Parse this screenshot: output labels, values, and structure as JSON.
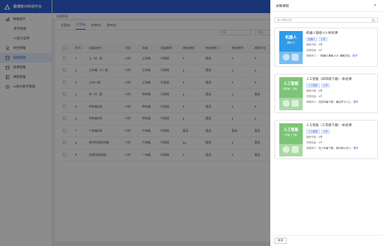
{
  "brand": {
    "title": "猫博智AI科创平台"
  },
  "sidebar": {
    "items": [
      {
        "label": "数据统计",
        "icon": "chart-icon",
        "expanded": true
      },
      {
        "label": "教学数据",
        "sub": true
      },
      {
        "label": "AI能力运用",
        "sub": true
      },
      {
        "label": "师生管理",
        "icon": "user-icon"
      },
      {
        "label": "班级管理",
        "icon": "class-icon",
        "active": true
      },
      {
        "label": "排课管理",
        "icon": "calendar-icon"
      },
      {
        "label": "课程管理",
        "icon": "book-icon"
      },
      {
        "label": "AI能力教学管理",
        "icon": "ai-icon"
      }
    ]
  },
  "breadcrumb": "班级管理",
  "tabs": [
    {
      "label": "全部(9)"
    },
    {
      "label": "小学(9)",
      "active": true
    },
    {
      "label": "初中(0)"
    },
    {
      "label": "高中(0)"
    }
  ],
  "filters": {
    "left": "年级",
    "right": "班级"
  },
  "table": {
    "headers": [
      "",
      "序号",
      "班级名称 ↕",
      "学段",
      "年级",
      "班级属性",
      "关联课程",
      "附加课程 ⓘ",
      "关联教师",
      "关联学生"
    ],
    "rows": [
      [
        "1",
        "三（5）班",
        "小学",
        "三年级",
        "行政班",
        "2",
        "暂无",
        "1",
        "3"
      ],
      [
        "2",
        "三年级（1）班",
        "小学",
        "三年级",
        "行政班",
        "3",
        "暂无",
        "1",
        "3"
      ],
      [
        "3",
        "三年二班",
        "小学",
        "三年级",
        "行政班",
        "4",
        "暂无",
        "1",
        "3"
      ],
      [
        "4",
        "四（2）班",
        "小学",
        "四年级",
        "行政班",
        "0",
        "暂无",
        "1",
        "暂无"
      ],
      [
        "5",
        "四年级1班",
        "小学",
        "四年级",
        "行政班",
        "3",
        "暂无",
        "1",
        "4"
      ],
      [
        "6",
        "四年级2班",
        "小学",
        "四年级",
        "行政班",
        "5",
        "暂无",
        "4",
        "2"
      ],
      [
        "7",
        "六年级1班",
        "小学",
        "六年级",
        "行政班",
        "暂无",
        "暂无",
        "暂无",
        "暂无"
      ],
      [
        "8",
        "林子的测试班级",
        "小学",
        "六年级",
        "行政班",
        "34",
        "暂无",
        "2",
        "暂无"
      ],
      [
        "9",
        "这是测试班级",
        "小学",
        "一年级",
        "行政班",
        "1",
        "暂无",
        "1",
        "暂无"
      ]
    ]
  },
  "drawer": {
    "title": "关联课程",
    "search_placeholder": "输入课程名称",
    "cancel_label": "取消",
    "more_label": "展开",
    "label_count": "课程节数：",
    "label_class": "关联班级：",
    "label_intro": "课程简介：",
    "courses": [
      {
        "name": "机器人基础-C1-体验课",
        "tags": [
          "机器人",
          "小学"
        ],
        "lessons": "2节",
        "classes": "1个",
        "intro": "《机器人基础-C1》课程共包...",
        "thumb_text": "机器人",
        "thumb_sub": "基础·C1",
        "thumb_color": "#2f9be8"
      },
      {
        "name": "人工智能（四年级下册）-体验课",
        "tags": [
          "人工智能",
          "小学"
        ],
        "lessons": "2节",
        "classes": "1个",
        "intro": "在四年级下册，通过学习人工...",
        "thumb_text": "人工智能",
        "thumb_sub": "四年级（下册）",
        "thumb_color": "#7cc576"
      },
      {
        "name": "人工智能（三年级下册）-体验课",
        "tags": [
          "人工智能",
          "小学"
        ],
        "lessons": "2节",
        "classes": "1个",
        "intro": "在三年级下册，我们将认识人...",
        "thumb_text": "人工智能",
        "thumb_sub": "三年级（下册）",
        "thumb_color": "#7cc576"
      }
    ]
  }
}
